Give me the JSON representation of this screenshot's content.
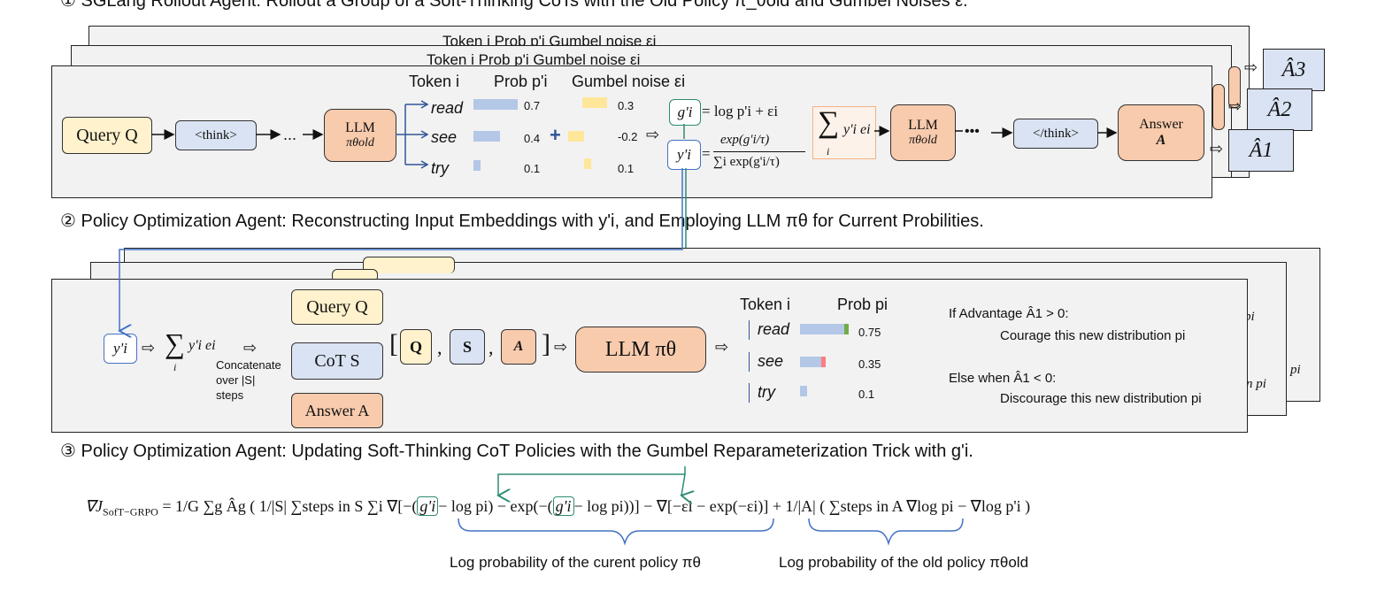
{
  "section1": {
    "heading": "① SGLang Rollout Agent: Rollout a Group of a Soft-Thinking CoTs with the Old Policy π_θold and Gumbel Noises ε.",
    "back_header_1": "Token  i     Prob p'i     Gumbel noise εi",
    "back_header_2": "Token  i     Prob p'i     Gumbel noise εi",
    "col_token": "Token  i",
    "col_prob": "Prob p'i",
    "col_gumbel": "Gumbel noise εi",
    "query": "Query Q",
    "think": "<think>",
    "ellipsis": "...",
    "llm": "LLM",
    "llm_sub": "πθold",
    "tokens": [
      {
        "word": "read",
        "prob": "0.7",
        "prob_value": 0.7,
        "noise": "0.3",
        "noise_value": 0.3
      },
      {
        "word": "see",
        "prob": "0.4",
        "prob_value": 0.4,
        "noise": "-0.2",
        "noise_value": 0.2
      },
      {
        "word": "try",
        "prob": "0.1",
        "prob_value": 0.1,
        "noise": "0.1",
        "noise_value": 0.1
      }
    ],
    "plus": "+",
    "g_label": "g'i",
    "g_formula": "= log p'i + εi",
    "y_label": "y'i",
    "y_formula_num": "exp(g'i/τ)",
    "y_formula_den": "∑i exp(g'i/τ)",
    "sum_expr": "y'i ei",
    "llm2": "LLM",
    "llm2_sub": "πθold",
    "dots": "•••",
    "end_think": "</think>",
    "answer": "Answer",
    "answer_sym": "A",
    "advantages": [
      "Â3",
      "Â2",
      "Â1"
    ]
  },
  "section2": {
    "heading": "② Policy Optimization Agent: Reconstructing Input Embeddings with y'i, and Employing LLM πθ for Current Probilities.",
    "y_label": "y'i",
    "sum_expr": "y'i ei",
    "concat_note": [
      "Concatenate",
      "over |S|",
      "steps"
    ],
    "query": "Query Q",
    "cot": "CoT S",
    "answer": "Answer A",
    "bracket_open": "[",
    "bracket_close": "]",
    "items": [
      "Q",
      "S",
      "A"
    ],
    "comma": ",",
    "llm": "LLM πθ",
    "col_token": "Token  i",
    "col_prob": "Prob pi",
    "tokens": [
      {
        "word": "read",
        "prob": "0.75",
        "prob_value": 0.75,
        "delta": "up"
      },
      {
        "word": "see",
        "prob": "0.35",
        "prob_value": 0.35,
        "delta": "down"
      },
      {
        "word": "try",
        "prob": "0.1",
        "prob_value": 0.1,
        "delta": "none"
      }
    ],
    "adv_pos_1": "If Advantage Â1 > 0:",
    "adv_pos_2": "Courage this new distribution pi",
    "adv_neg_1": "Else when Â1 < 0:",
    "adv_neg_2": "Discourage this new distribution pi",
    "back_fragments": [
      "pi",
      "n pi",
      "pi"
    ]
  },
  "section3": {
    "heading": "③ Policy Optimization Agent: Updating Soft-Thinking CoT Policies with the Gumbel Reparameterization Trick with g'i.",
    "formula": {
      "lhs": "∇J",
      "lhs_sub": "SofT−GRPO",
      "eq": "=",
      "part1": "1/G ∑g Âg ( 1/|S| ∑steps in S ∑i ∇[−(",
      "g1": "g'i",
      "part2": "− log pi) − exp(−(",
      "g2": "g'i",
      "part3": "− log pi))] − ∇[−εi − exp(−εi)] + 1/|A| ( ∑steps in A ∇log pi − ∇log p'i )"
    },
    "brace_label_current": "Log probability of the curent policy πθ",
    "brace_label_old": "Log probability of the old policy πθold"
  }
}
